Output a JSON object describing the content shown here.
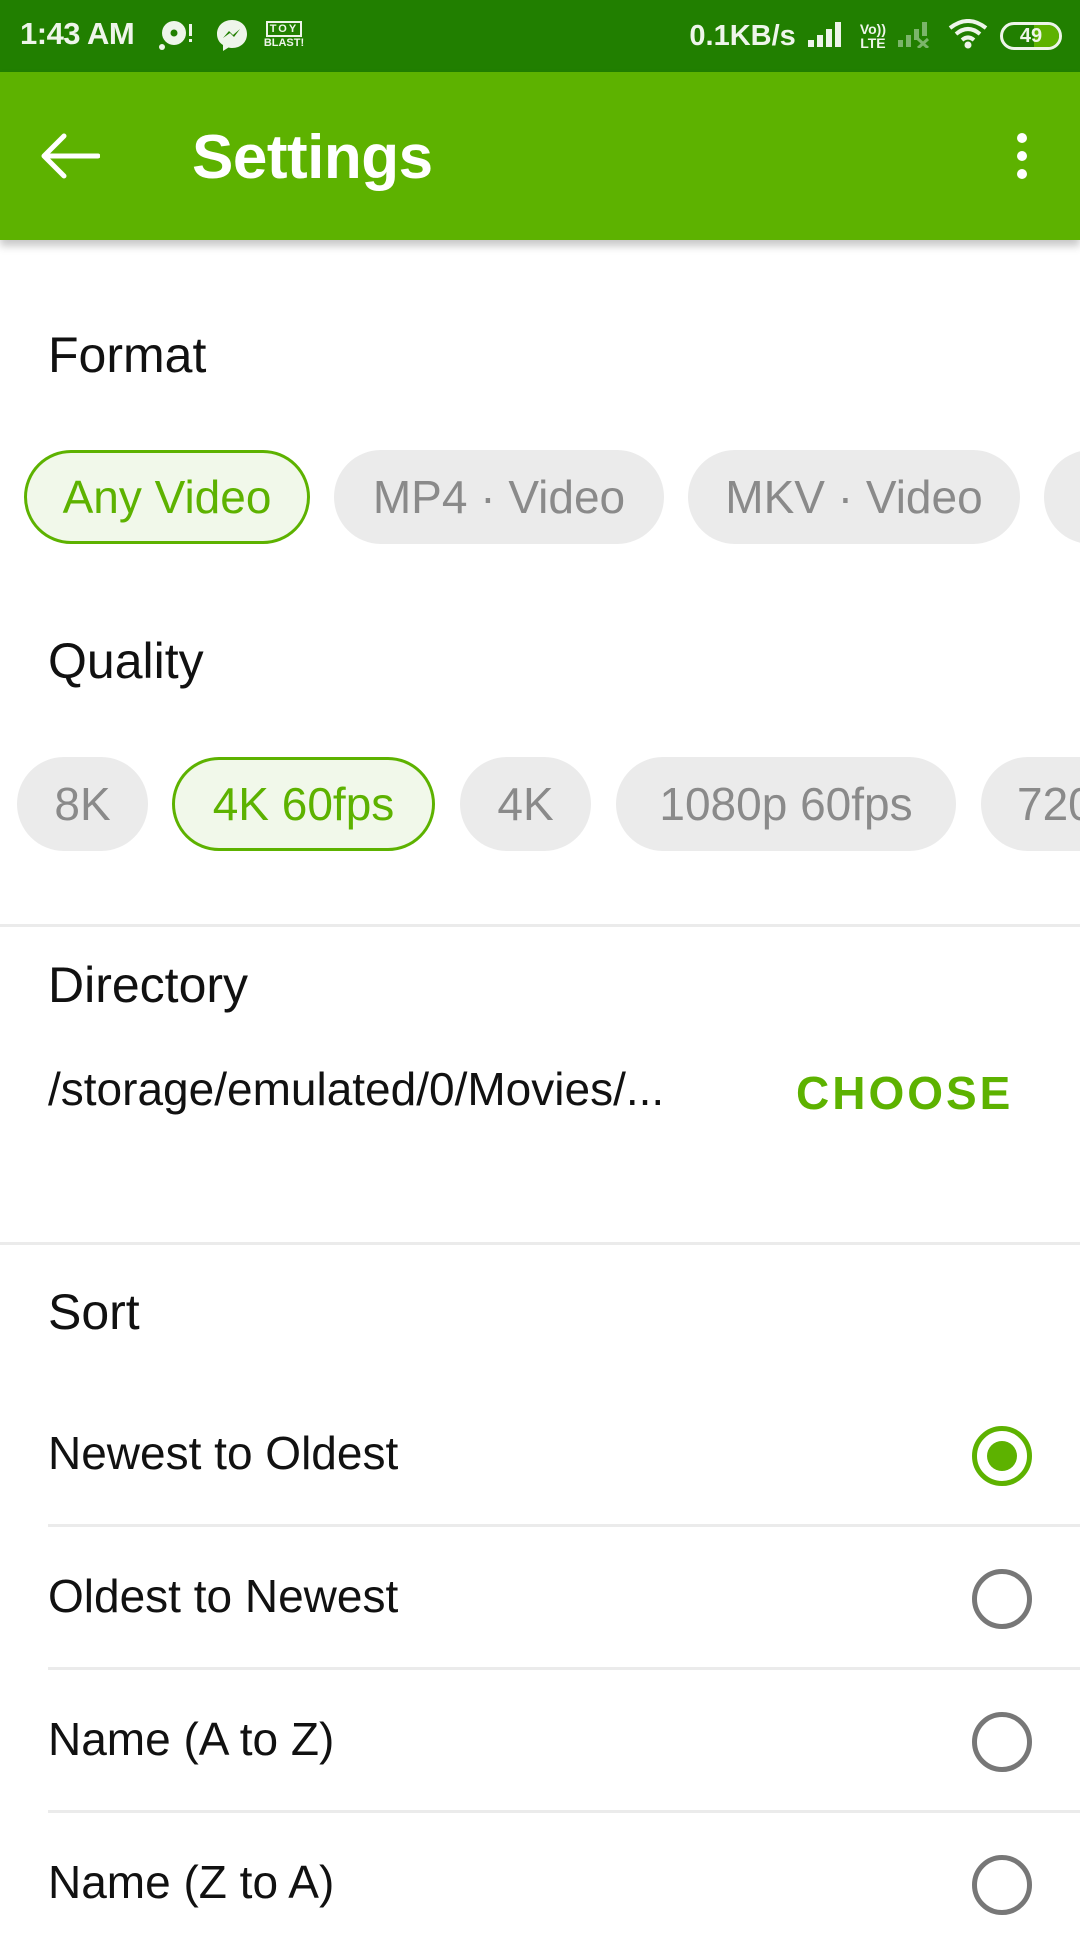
{
  "status_bar": {
    "time": "1:43 AM",
    "notification_icons": [
      "music-notification-icon",
      "messenger-icon",
      "toy-blast-icon"
    ],
    "toy_blast_label_top": "TOY",
    "toy_blast_label_bottom": "BLAST!",
    "network_speed": "0.1KB/s",
    "volte_label_top": "Vo))",
    "volte_label_bottom": "LTE",
    "battery_level": "49",
    "colors": {
      "background": "#217f00",
      "foreground": "#eef5ea"
    }
  },
  "app_bar": {
    "title": "Settings",
    "back_icon": "arrow-left-icon",
    "menu_icon": "more-vert-icon",
    "color": "#5db200"
  },
  "format": {
    "label": "Format",
    "options": [
      {
        "label": "Any Video",
        "selected": true
      },
      {
        "label": "MP4 · Video",
        "selected": false
      },
      {
        "label": "MKV · Video",
        "selected": false
      },
      {
        "label": "",
        "selected": false
      }
    ]
  },
  "quality": {
    "label": "Quality",
    "options": [
      {
        "label": "8K",
        "selected": false
      },
      {
        "label": "4K 60fps",
        "selected": true
      },
      {
        "label": "4K",
        "selected": false
      },
      {
        "label": "1080p 60fps",
        "selected": false
      },
      {
        "label": "720",
        "selected": false
      }
    ]
  },
  "directory": {
    "label": "Directory",
    "path": "/storage/emulated/0/Movies/...",
    "choose_label": "CHOOSE"
  },
  "sort": {
    "label": "Sort",
    "options": [
      {
        "label": "Newest to Oldest",
        "selected": true
      },
      {
        "label": "Oldest to Newest",
        "selected": false
      },
      {
        "label": "Name (A to Z)",
        "selected": false
      },
      {
        "label": "Name (Z to A)",
        "selected": false
      }
    ]
  },
  "colors": {
    "accent": "#5db200",
    "chip_background": "#ebebeb",
    "chip_text": "#8a8a8a",
    "selected_chip_background": "#f1f8ea"
  }
}
